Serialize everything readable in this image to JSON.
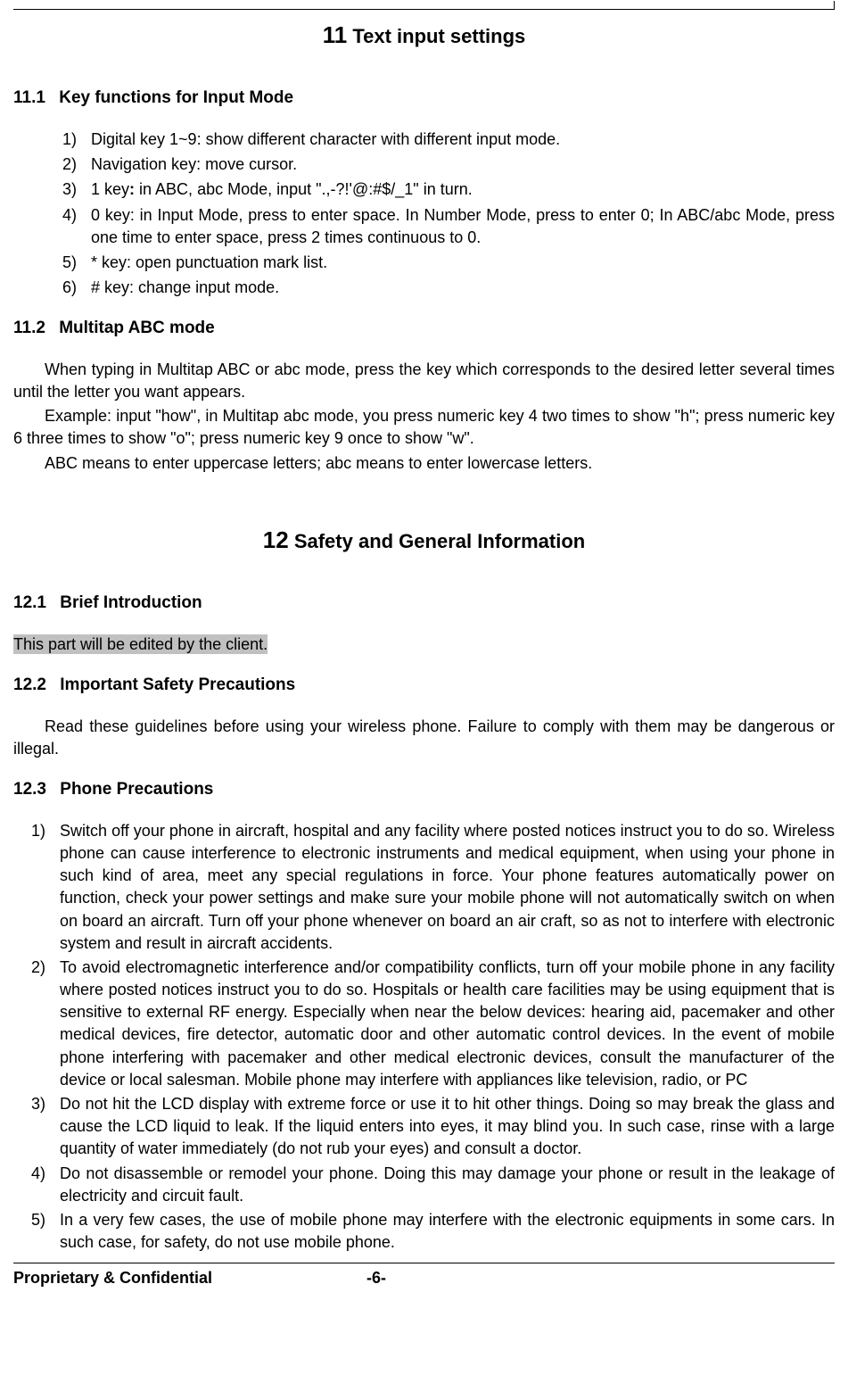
{
  "chapter11": {
    "number": "11",
    "title": "Text input settings"
  },
  "section11_1": {
    "number": "11.1",
    "title": "Key functions for Input Mode",
    "items": [
      {
        "num": "1)",
        "text": "Digital key 1~9: show different character with different input mode."
      },
      {
        "num": "2)",
        "text": "Navigation key: move cursor."
      },
      {
        "num": "3)",
        "text_prefix": "1 key",
        "text_bold": ":",
        "text_suffix": " in ABC, abc Mode, input \".,-?!'@:#$/_1\" in turn."
      },
      {
        "num": "4)",
        "text": "0 key: in Input Mode, press to enter space. In Number Mode, press to enter 0; In ABC/abc Mode, press one time to enter space, press 2 times continuous to 0."
      },
      {
        "num": "5)",
        "text": "* key: open punctuation mark list."
      },
      {
        "num": "6)",
        "text": "# key: change input mode."
      }
    ]
  },
  "section11_2": {
    "number": "11.2",
    "title": "Multitap ABC mode",
    "para1": "When typing in Multitap ABC or abc mode, press the key which corresponds to the desired letter several times until the letter you want appears.",
    "para2": "Example: input \"how\", in Multitap abc mode, you press numeric key 4 two times to show \"h\"; press numeric key 6 three times to show \"o\"; press numeric key 9 once to show \"w\".",
    "para3": "ABC means to enter uppercase letters; abc means to enter lowercase letters."
  },
  "chapter12": {
    "number": "12",
    "title": "Safety and General Information"
  },
  "section12_1": {
    "number": "12.1",
    "title": "Brief Introduction",
    "highlighted": "This part will be edited by the client."
  },
  "section12_2": {
    "number": "12.2",
    "title": "Important Safety Precautions",
    "para": "Read these guidelines before using your wireless phone. Failure to comply with them may be dangerous or illegal."
  },
  "section12_3": {
    "number": "12.3",
    "title": "Phone Precautions",
    "items": [
      {
        "num": "1)",
        "text": "Switch off your phone in aircraft, hospital and any facility where posted notices instruct you to do so. Wireless phone can cause interference to electronic instruments and medical equipment, when using your phone in such kind of area, meet any special regulations in force. Your phone features automatically power on function, check your power settings and make sure your mobile phone will not automatically switch on when on board an aircraft. Turn off your phone whenever on board an air craft, so as not to interfere with electronic system and result in aircraft accidents."
      },
      {
        "num": "2)",
        "text": "To avoid electromagnetic interference and/or compatibility conflicts, turn off your mobile phone in any facility where posted notices instruct you to do so. Hospitals or health care facilities may be using equipment that is sensitive to external RF energy. Especially when near the below devices: hearing aid, pacemaker and other medical devices, fire detector, automatic door and other automatic control devices. In the event of mobile phone interfering with pacemaker and other medical electronic devices, consult the manufacturer of the device or local salesman. Mobile phone may interfere with appliances like television, radio, or PC"
      },
      {
        "num": "3)",
        "text": "Do not hit the LCD display with extreme force or use it to hit other things. Doing so may break the glass and cause the LCD liquid to leak. If the liquid enters into eyes, it may blind you. In such case, rinse with a large quantity of water immediately (do not rub your eyes) and consult a doctor."
      },
      {
        "num": "4)",
        "text": "Do not disassemble or remodel your phone. Doing this may damage your phone or result in the leakage of electricity and circuit fault."
      },
      {
        "num": "5)",
        "text": "In a very few cases, the use of mobile phone may interfere with the electronic equipments in some cars. In such case, for safety, do not use mobile phone."
      }
    ]
  },
  "footer": {
    "left": "Proprietary & Confidential",
    "center": "-6-"
  }
}
